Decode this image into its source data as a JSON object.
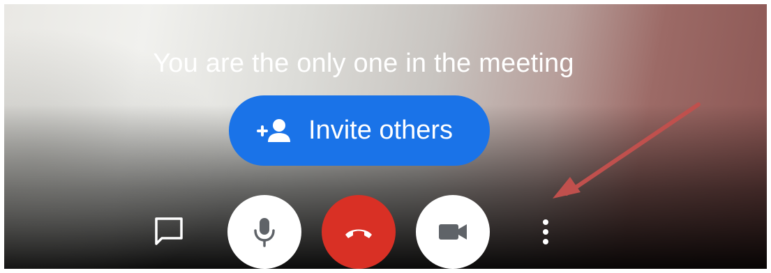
{
  "meeting": {
    "status_message": "You are the only one in the meeting",
    "invite_label": "Invite others"
  },
  "icons": {
    "invite": "person-add-icon",
    "chat": "chat-bubble-icon",
    "mic": "microphone-icon",
    "hangup": "phone-hangup-icon",
    "camera": "video-camera-icon",
    "more": "more-vertical-icon",
    "annotation": "red-arrow-annotation"
  },
  "colors": {
    "invite_button": "#1a73e8",
    "hangup_button": "#d93025",
    "annotation_arrow": "#c0504d"
  }
}
